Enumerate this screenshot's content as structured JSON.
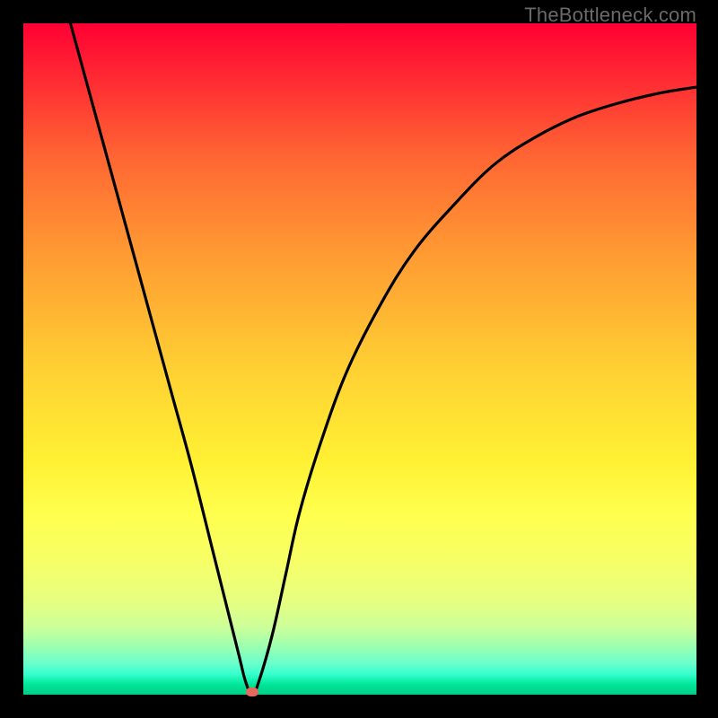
{
  "watermark": "TheBottleneck.com",
  "colors": {
    "frame_background": "#000000",
    "curve_stroke": "#000000",
    "marker_fill": "#e36a5c",
    "watermark_text": "#6a6a6a"
  },
  "chart_data": {
    "type": "line",
    "title": "",
    "xlabel": "",
    "ylabel": "",
    "xlim": [
      0,
      100
    ],
    "ylim": [
      0,
      100
    ],
    "grid": false,
    "legend": false,
    "background": "vertical-rainbow-gradient",
    "series": [
      {
        "name": "curve",
        "x": [
          7,
          10,
          13,
          16,
          19,
          22,
          25,
          28,
          30,
          32,
          33,
          34,
          35,
          37,
          39,
          41,
          44,
          48,
          53,
          58,
          64,
          70,
          76,
          82,
          88,
          94,
          100
        ],
        "y": [
          100,
          89,
          78,
          67,
          56,
          45,
          34,
          22,
          14,
          6,
          2,
          0,
          2,
          9,
          18,
          27,
          37,
          48,
          58,
          66,
          73,
          79,
          83,
          86,
          88,
          89.5,
          90.5
        ]
      }
    ],
    "markers": [
      {
        "name": "minimum-marker",
        "x": 34,
        "y": 0
      }
    ]
  }
}
